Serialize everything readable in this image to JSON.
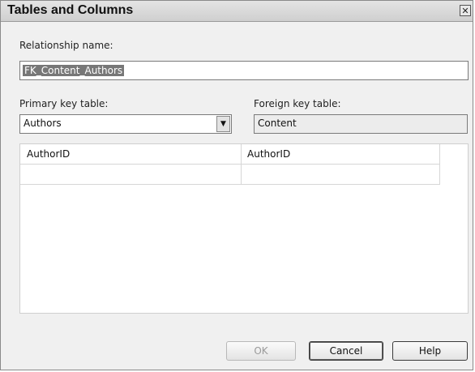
{
  "dialog": {
    "title": "Tables and Columns",
    "close_glyph": "✕"
  },
  "relationship": {
    "label": "Relationship name:",
    "value": "FK_Content_Authors"
  },
  "primary_key": {
    "label": "Primary key table:",
    "value": "Authors",
    "dropdown_glyph": "▼"
  },
  "foreign_key": {
    "label": "Foreign key table:",
    "value": "Content"
  },
  "columns_grid": {
    "headers": [
      "AuthorID",
      "AuthorID"
    ],
    "rows": [
      [
        "",
        ""
      ]
    ]
  },
  "buttons": {
    "ok": "OK",
    "cancel": "Cancel",
    "help": "Help"
  }
}
